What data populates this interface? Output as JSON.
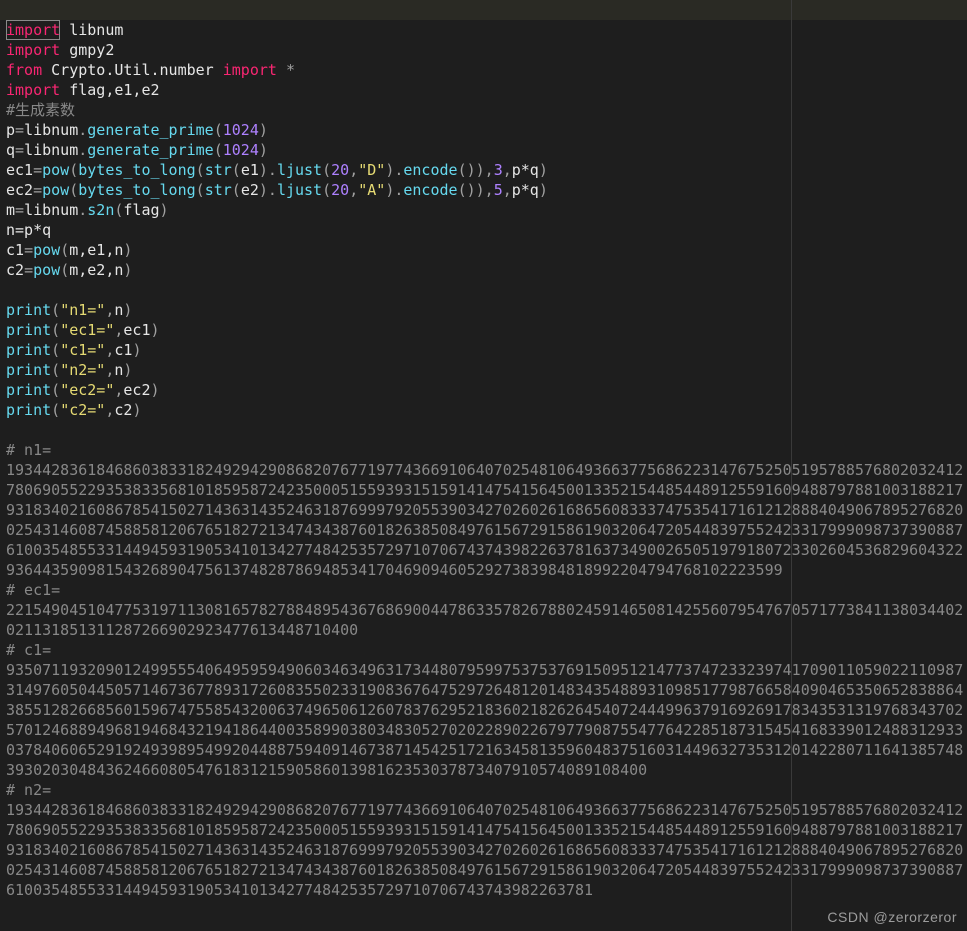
{
  "watermark": "CSDN @zerorzeror",
  "code": {
    "L1": {
      "kw_import": "import",
      "mod": "libnum"
    },
    "L2": {
      "kw_import": "import",
      "mod": "gmpy2"
    },
    "L3": {
      "kw_from": "from",
      "mod": "Crypto.Util.number",
      "kw_import": "import",
      "star": "*"
    },
    "L4": {
      "kw_import": "import",
      "mods": "flag,e1,e2"
    },
    "L5": {
      "comment": "#生成素数"
    },
    "L6": {
      "lhs": "p",
      "eq": "=",
      "mod": "libnum",
      "dot": ".",
      "fn": "generate_prime",
      "arg": "1024"
    },
    "L7": {
      "lhs": "q",
      "eq": "=",
      "mod": "libnum",
      "dot": ".",
      "fn": "generate_prime",
      "arg": "1024"
    },
    "L8": {
      "lhs": "ec1",
      "eq": "=",
      "pow": "pow",
      "btl": "bytes_to_long",
      "str": "str",
      "e": "e1",
      "ljust": "ljust",
      "lj_n": "20",
      "lj_c": "\"D\"",
      "enc": "encode",
      "exp": "3",
      "mod": "p*q"
    },
    "L9": {
      "lhs": "ec2",
      "eq": "=",
      "pow": "pow",
      "btl": "bytes_to_long",
      "str": "str",
      "e": "e2",
      "ljust": "ljust",
      "lj_n": "20",
      "lj_c": "\"A\"",
      "enc": "encode",
      "exp": "5",
      "mod": "p*q"
    },
    "L10": {
      "lhs": "m",
      "eq": "=",
      "mod": "libnum",
      "dot": ".",
      "fn": "s2n",
      "arg": "flag"
    },
    "L11": {
      "txt": "n=p*q"
    },
    "L12": {
      "lhs": "c1",
      "eq": "=",
      "fn": "pow",
      "args": "m,e1,n"
    },
    "L13": {
      "lhs": "c2",
      "eq": "=",
      "fn": "pow",
      "args": "m,e2,n"
    },
    "L15": {
      "fn": "print",
      "label": "\"n1=\"",
      "var": "n"
    },
    "L16": {
      "fn": "print",
      "label": "\"ec1=\"",
      "var": "ec1"
    },
    "L17": {
      "fn": "print",
      "label": "\"c1=\"",
      "var": "c1"
    },
    "L18": {
      "fn": "print",
      "label": "\"n2=\"",
      "var": "n"
    },
    "L19": {
      "fn": "print",
      "label": "\"ec2=\"",
      "var": "ec2"
    },
    "L20": {
      "fn": "print",
      "label": "\"c2=\"",
      "var": "c2"
    }
  },
  "output": {
    "n1_label": "# n1=",
    "n1_value": "1934428361846860383318249294290868207677197743669106407025481064936637756862231476752505195788576802032412780690552293538335681018595872423500051559393151591414754156450013352154485448912559160948879788100318821793183402160867854150271436314352463187699979205539034270260261686560833374753541716121288840490678952768200254314608745885812067651827213474343876018263850849761567291586190320647205448397552423317999098737390887610035485533144945931905341013427748425357297107067437439822637816373490026505197918072330260453682960432293644359098154326890475613748287869485341704690946052927383984818992204794768102223599",
    "ec1_label": "# ec1=",
    "ec1_value": "2215490451047753197113081657827884895436768690044786335782678802459146508142556079547670571773841138034402021131851311287266902923477613448710400",
    "c1_label": "# c1=",
    "c1_value": "9350711932090124995554064959594906034634963173448079599753753769150951214773747233239741709011059022110987314976050445057146736778931726083550233190836764752972648120148343548893109851779876658409046535065283886438551282668560159674755854320063749650612607837629521836021826264540724449963791692691783435313197683437025701246889496819468432194186440035899038034830527020228902267977908755477642285187315454168339012488312933037840606529192493989549920448875940914673871454251721634581359604837516031449632735312014228071164138574839302030484362466080547618312159058601398162353037873407910574089108400",
    "n2_label": "# n2=",
    "n2_value_partial": "193442836184686038331824929429086820767719774366910640702548106493663775686223147675250519578857680203241278069055229353833568101859587242350005155939315159141475415645001335215448544891255916094887978810031882179318340216086785415027143631435246318769997920553903427026026168656083337475354171612128884049067895276820025431460874588581206765182721347434387601826385084976156729158619032064720544839755242331799909873739088761003548553314494593190534101342774842535729710706743743982263781"
  }
}
